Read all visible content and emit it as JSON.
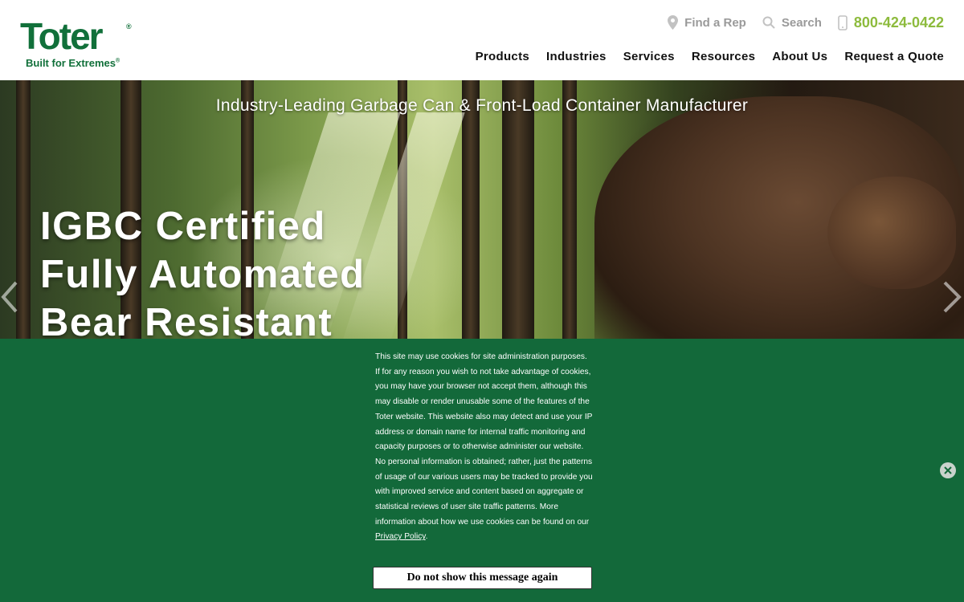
{
  "brand": {
    "name": "Toter",
    "registered_mark": "®",
    "tagline": "Built for Extremes",
    "tagline_mark": "®",
    "color": "#11703a"
  },
  "utility": {
    "find_rep": "Find a Rep",
    "search": "Search",
    "phone": "800-424-0422",
    "phone_color": "#8dbb3d"
  },
  "nav": {
    "items": [
      "Products",
      "Industries",
      "Services",
      "Resources",
      "About Us",
      "Request a Quote"
    ]
  },
  "hero": {
    "subtitle": "Industry-Leading Garbage Can & Front-Load Container Manufacturer",
    "headline": [
      "IGBC Certified",
      "Fully Automated",
      "Bear Resistant"
    ]
  },
  "cookie": {
    "text": "This site may use cookies for site administration purposes. If for any reason you wish to not take advantage of cookies, you may have your browser not accept them, although this may disable or render unusable some of the features of the Toter website. This website also may detect and use your IP address or domain name for internal traffic monitoring and capacity purposes or to otherwise administer our website. No personal information is obtained; rather, just the patterns of usage of our various users may be tracked to provide you with improved service and content based on aggregate or statistical reviews of user site traffic patterns. More information about how we use cookies can be found on our ",
    "link": "Privacy Policy",
    "text_end": ".",
    "button": "Do not show this message again",
    "background": "#13693a"
  }
}
